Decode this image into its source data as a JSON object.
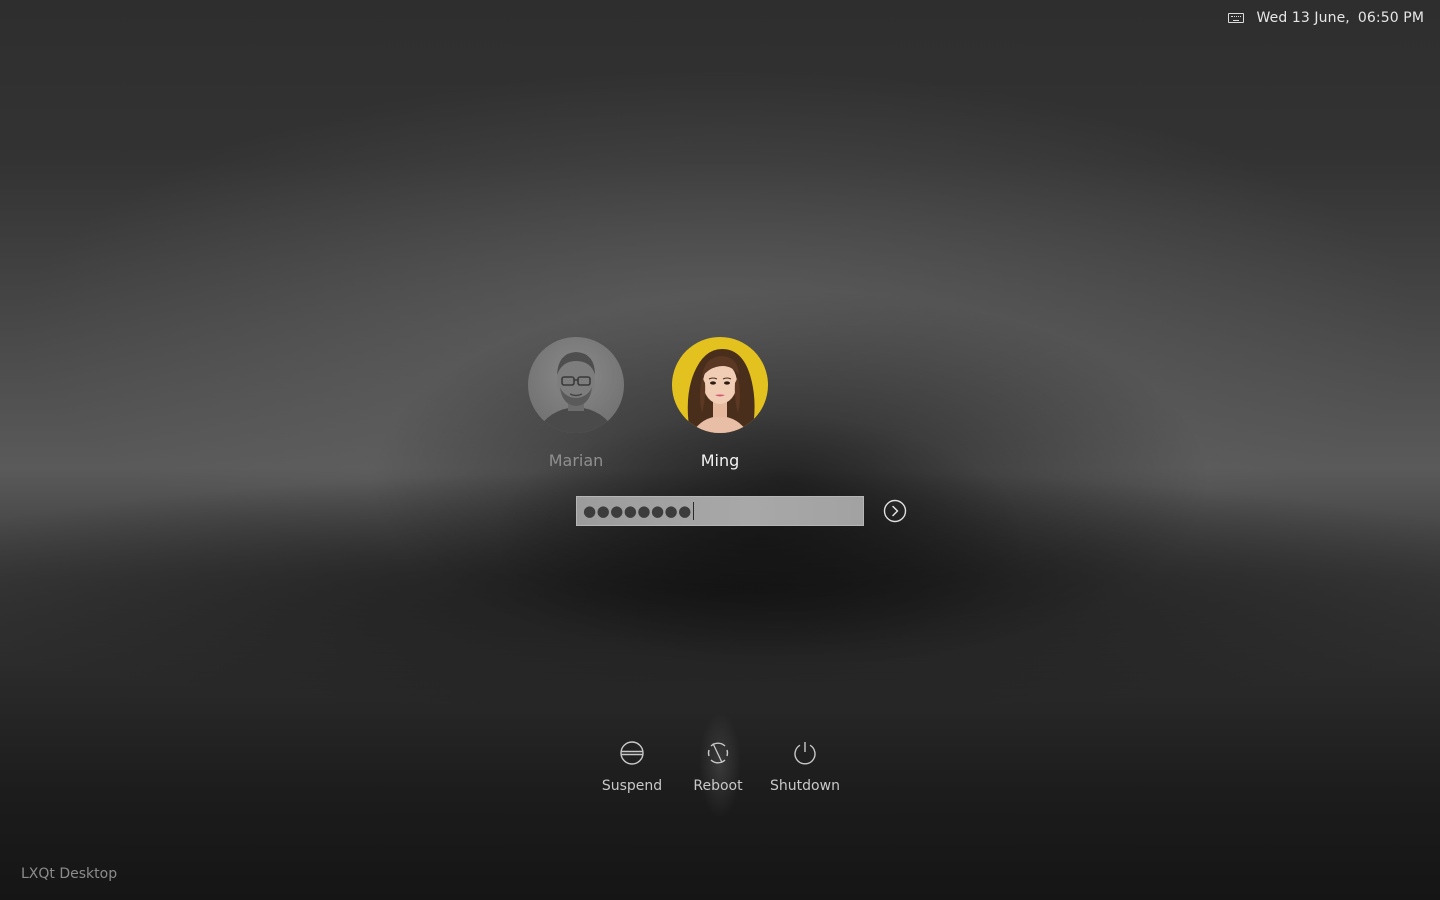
{
  "topbar": {
    "keyboard_icon": "keyboard-icon",
    "date": "Wed 13 June,",
    "time": "06:50 PM"
  },
  "users": [
    {
      "name": "Marian",
      "selected": false
    },
    {
      "name": "Ming",
      "selected": true
    }
  ],
  "password": {
    "masked_value": "●●●●●●●●",
    "submit_icon": "arrow-right-circle-icon"
  },
  "actions": {
    "suspend": {
      "label": "Suspend",
      "icon": "suspend-icon"
    },
    "reboot": {
      "label": "Reboot",
      "icon": "reboot-icon"
    },
    "shutdown": {
      "label": "Shutdown",
      "icon": "power-icon"
    }
  },
  "session": {
    "name": "LXQt Desktop"
  },
  "colors": {
    "text_primary": "#f2f2f2",
    "text_dim": "#8f8f8f",
    "field_bg": "#a4a4a4",
    "ming_avatar_bg": "#e3c21f"
  }
}
